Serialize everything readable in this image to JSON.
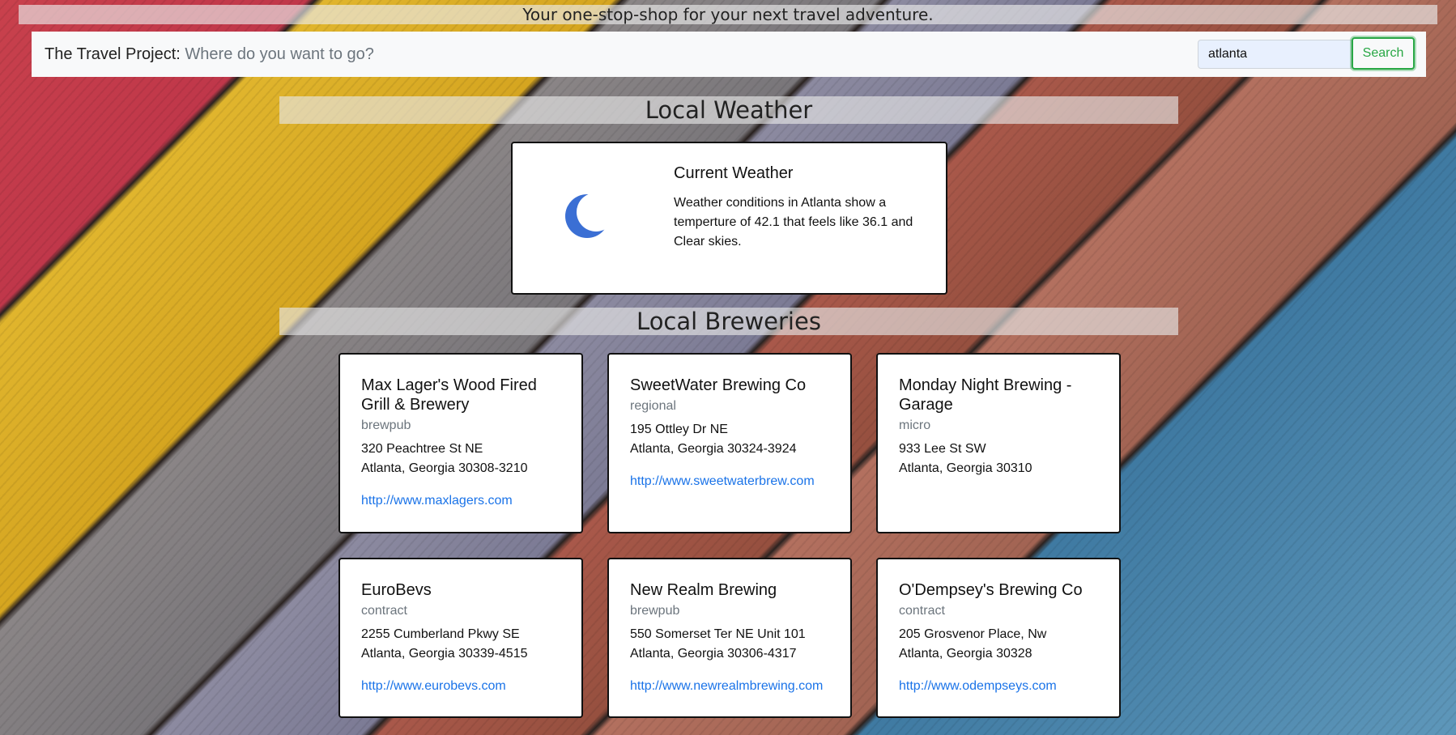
{
  "tagline": "Your one-stop-shop for your next travel adventure.",
  "navbar": {
    "brand": "The Travel Project:",
    "subtitle": "Where do you want to go?",
    "search_value": "atlanta",
    "search_button": "Search"
  },
  "weather": {
    "section_title": "Local Weather",
    "card_title": "Current Weather",
    "icon": "moon-icon",
    "description": "Weather conditions in Atlanta show a temperture of 42.1 that feels like 36.1 and Clear skies."
  },
  "breweries": {
    "section_title": "Local Breweries",
    "items": [
      {
        "name": "Max Lager's Wood Fired Grill & Brewery",
        "type": "brewpub",
        "street": "320 Peachtree St NE",
        "city": "Atlanta, Georgia 30308-3210",
        "url": "http://www.maxlagers.com"
      },
      {
        "name": "SweetWater Brewing Co",
        "type": "regional",
        "street": "195 Ottley Dr NE",
        "city": "Atlanta, Georgia 30324-3924",
        "url": "http://www.sweetwaterbrew.com"
      },
      {
        "name": "Monday Night Brewing - Garage",
        "type": "micro",
        "street": "933 Lee St SW",
        "city": "Atlanta, Georgia 30310",
        "url": ""
      },
      {
        "name": "EuroBevs",
        "type": "contract",
        "street": "2255 Cumberland Pkwy SE",
        "city": "Atlanta, Georgia 30339-4515",
        "url": "http://www.eurobevs.com"
      },
      {
        "name": "New Realm Brewing",
        "type": "brewpub",
        "street": "550 Somerset Ter NE Unit 101",
        "city": "Atlanta, Georgia 30306-4317",
        "url": "http://www.newrealmbrewing.com"
      },
      {
        "name": "O'Dempsey's Brewing Co",
        "type": "contract",
        "street": "205 Grosvenor Place, Nw",
        "city": "Atlanta, Georgia 30328",
        "url": "http://www.odempseys.com"
      }
    ]
  },
  "colors": {
    "accent_green": "#28a745",
    "link_blue": "#1a73e8",
    "moon_blue": "#3b6fd4"
  }
}
